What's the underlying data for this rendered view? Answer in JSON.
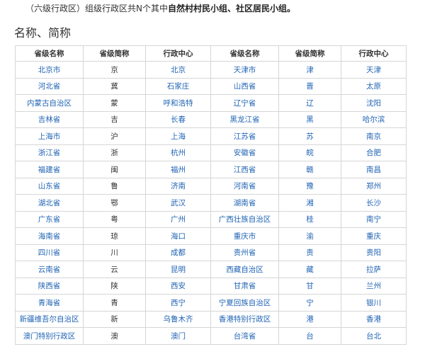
{
  "intro": {
    "prefix": "（六级行政区）组级行政区共N个其中",
    "bold1": "自然村村民小组",
    "sep": "、",
    "bold2": "社区居民小组",
    "suffix": "。"
  },
  "heading": "名称、简称",
  "table": {
    "headers": [
      "省级名称",
      "省级简称",
      "行政中心",
      "省级名称",
      "省级简称",
      "行政中心"
    ],
    "rows": [
      [
        "北京市",
        "京",
        "北京",
        "天津市",
        "津",
        "天津"
      ],
      [
        "河北省",
        "冀",
        "石家庄",
        "山西省",
        "晋",
        "太原"
      ],
      [
        "内蒙古自治区",
        "蒙",
        "呼和浩特",
        "辽宁省",
        "辽",
        "沈阳"
      ],
      [
        "吉林省",
        "吉",
        "长春",
        "黑龙江省",
        "黑",
        "哈尔滨"
      ],
      [
        "上海市",
        "沪",
        "上海",
        "江苏省",
        "苏",
        "南京"
      ],
      [
        "浙江省",
        "浙",
        "杭州",
        "安徽省",
        "皖",
        "合肥"
      ],
      [
        "福建省",
        "闽",
        "福州",
        "江西省",
        "赣",
        "南昌"
      ],
      [
        "山东省",
        "鲁",
        "济南",
        "河南省",
        "豫",
        "郑州"
      ],
      [
        "湖北省",
        "鄂",
        "武汉",
        "湖南省",
        "湘",
        "长沙"
      ],
      [
        "广东省",
        "粤",
        "广州",
        "广西壮族自治区",
        "桂",
        "南宁"
      ],
      [
        "海南省",
        "琼",
        "海口",
        "重庆市",
        "渝",
        "重庆"
      ],
      [
        "四川省",
        "川",
        "成都",
        "贵州省",
        "贵",
        "贵阳"
      ],
      [
        "云南省",
        "云",
        "昆明",
        "西藏自治区",
        "藏",
        "拉萨"
      ],
      [
        "陕西省",
        "陕",
        "西安",
        "甘肃省",
        "甘",
        "兰州"
      ],
      [
        "青海省",
        "青",
        "西宁",
        "宁夏回族自治区",
        "宁",
        "银川"
      ],
      [
        "新疆维吾尔自治区",
        "新",
        "乌鲁木齐",
        "香港特别行政区",
        "港",
        "香港"
      ],
      [
        "澳门特别行政区",
        "澳",
        "澳门",
        "台湾省",
        "台",
        "台北"
      ]
    ]
  }
}
